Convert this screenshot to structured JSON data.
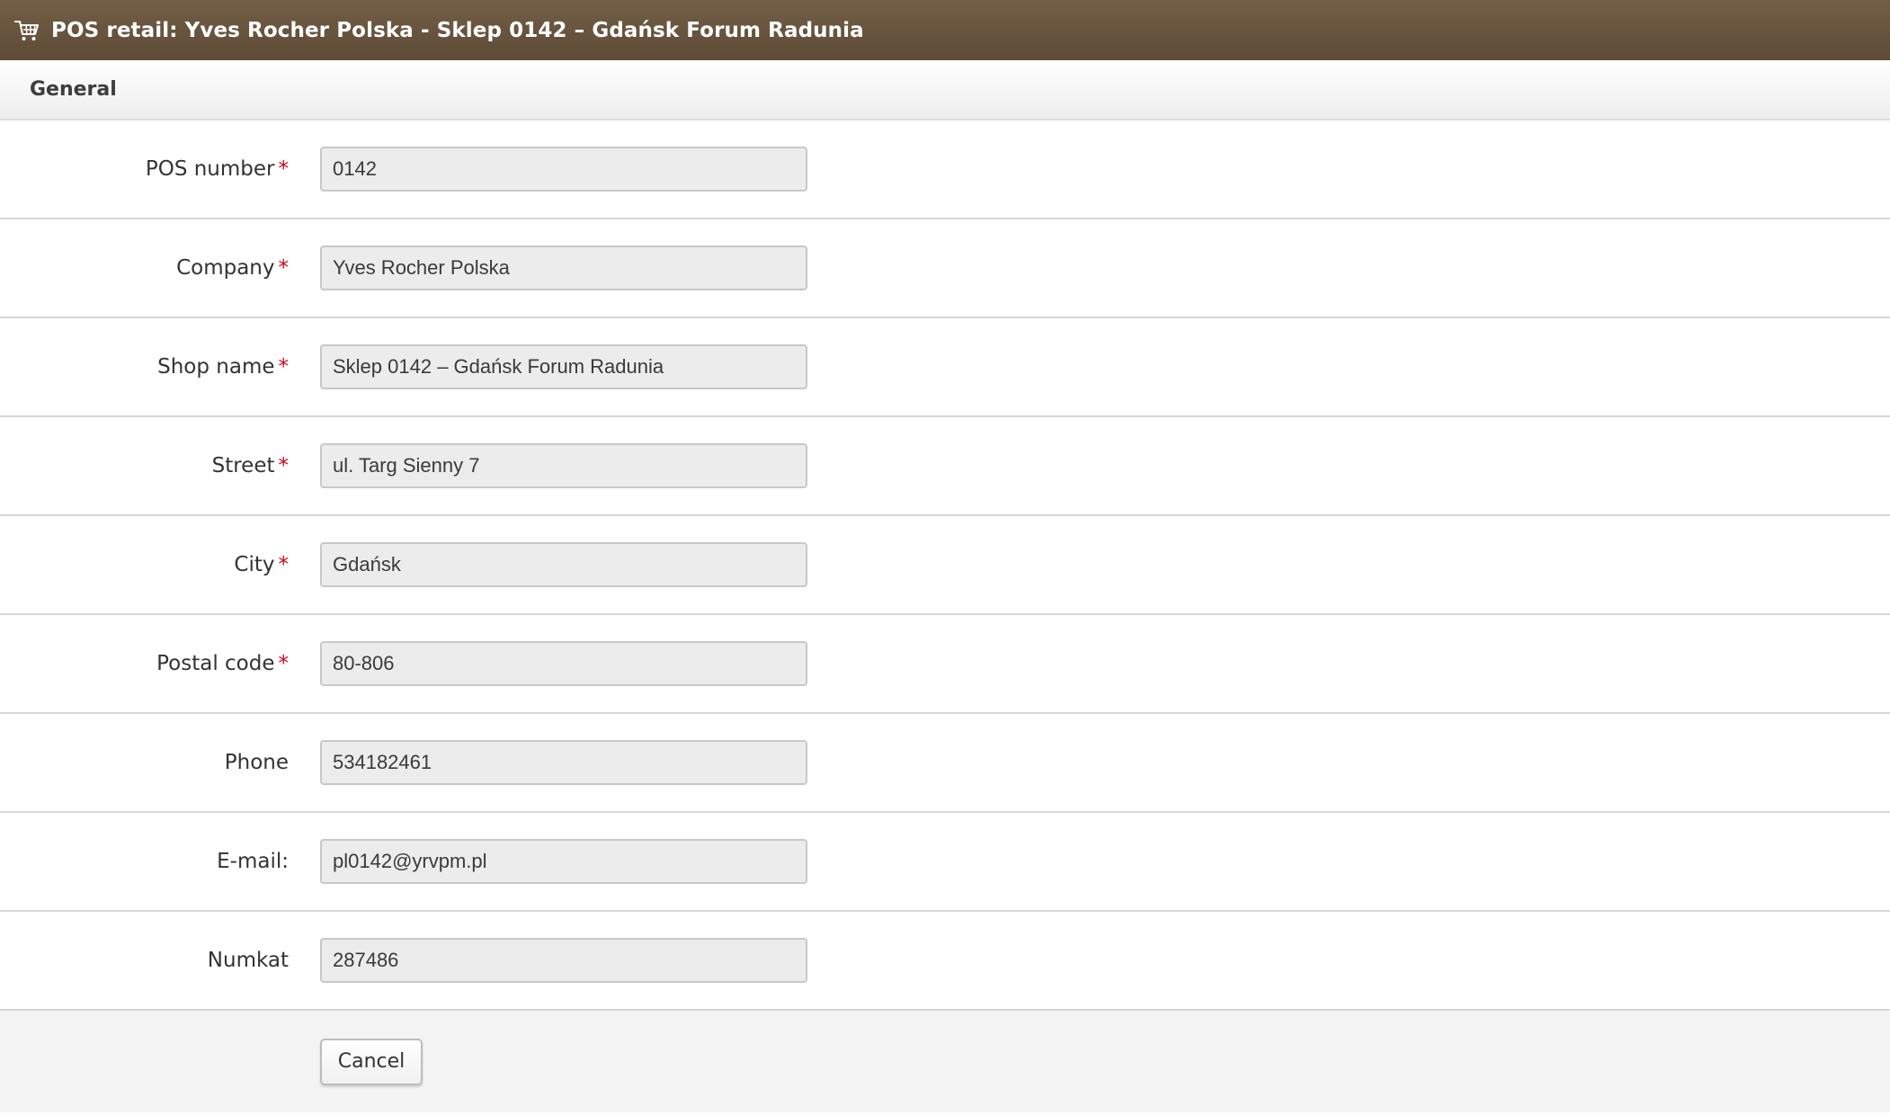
{
  "window": {
    "icon": "shopping-cart-icon",
    "title": "POS retail: Yves Rocher Polska - Sklep 0142 – Gdańsk Forum Radunia"
  },
  "section": {
    "title": "General"
  },
  "fields": [
    {
      "label": "POS number",
      "required": true,
      "value": "0142"
    },
    {
      "label": "Company",
      "required": true,
      "value": "Yves Rocher Polska"
    },
    {
      "label": "Shop name",
      "required": true,
      "value": "Sklep 0142 – Gdańsk Forum Radunia"
    },
    {
      "label": "Street",
      "required": true,
      "value": "ul. Targ Sienny 7"
    },
    {
      "label": "City",
      "required": true,
      "value": "Gdańsk"
    },
    {
      "label": "Postal code",
      "required": true,
      "value": "80-806"
    },
    {
      "label": "Phone",
      "required": false,
      "value": "534182461"
    },
    {
      "label": "E-mail:",
      "required": false,
      "value": "pl0142@yrvpm.pl"
    },
    {
      "label": "Numkat",
      "required": false,
      "value": "287486"
    }
  ],
  "required_marker": "*",
  "actions": {
    "cancel_label": "Cancel"
  },
  "colors": {
    "titlebar": "#6a5640",
    "required": "#d0021b",
    "field_bg": "#ececec"
  }
}
